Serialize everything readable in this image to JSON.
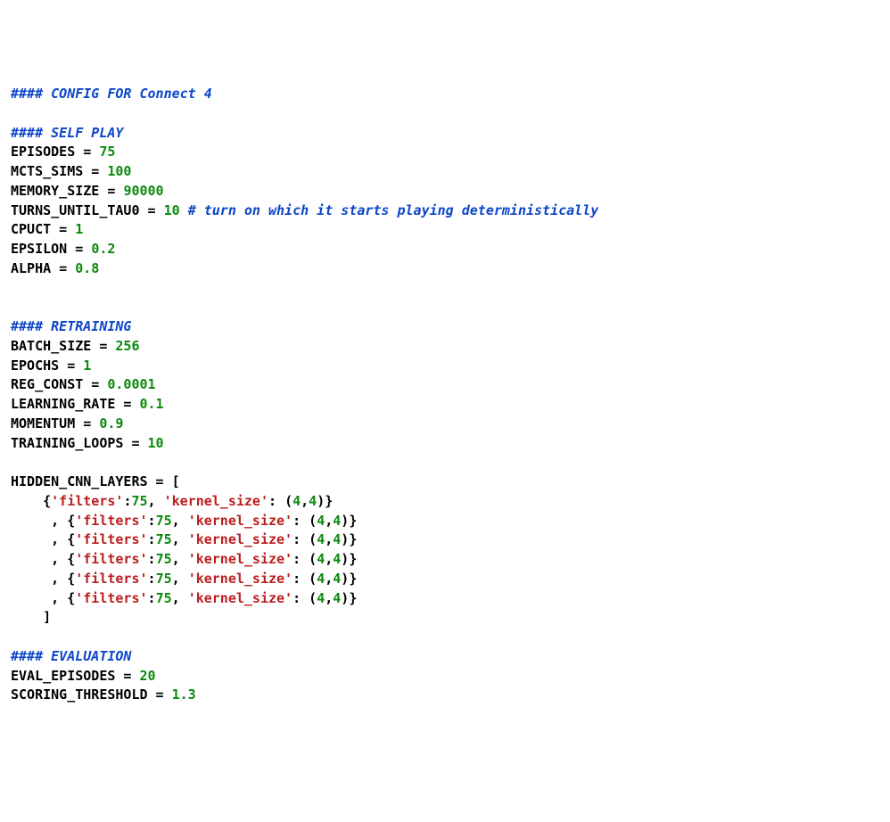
{
  "comments": {
    "title": "#### CONFIG FOR Connect 4",
    "selfplay": "#### SELF PLAY",
    "retraining": "#### RETRAINING",
    "evaluation": "#### EVALUATION",
    "tau_inline": "# turn on which it starts playing deterministically"
  },
  "selfplay": {
    "EPISODES": {
      "name": "EPISODES",
      "eq": " = ",
      "val": "75"
    },
    "MCTS_SIMS": {
      "name": "MCTS_SIMS",
      "eq": " = ",
      "val": "100"
    },
    "MEMORY_SIZE": {
      "name": "MEMORY_SIZE",
      "eq": " = ",
      "val": "90000"
    },
    "TURNS_UNTIL_TAU0": {
      "name": "TURNS_UNTIL_TAU0",
      "eq": " = ",
      "val": "10"
    },
    "CPUCT": {
      "name": "CPUCT",
      "eq": " = ",
      "val": "1"
    },
    "EPSILON": {
      "name": "EPSILON",
      "eq": " = ",
      "val": "0.2"
    },
    "ALPHA": {
      "name": "ALPHA",
      "eq": " = ",
      "val": "0.8"
    }
  },
  "retraining": {
    "BATCH_SIZE": {
      "name": "BATCH_SIZE",
      "eq": " = ",
      "val": "256"
    },
    "EPOCHS": {
      "name": "EPOCHS",
      "eq": " = ",
      "val": "1"
    },
    "REG_CONST": {
      "name": "REG_CONST",
      "eq": " = ",
      "val": "0.0001"
    },
    "LEARNING_RATE": {
      "name": "LEARNING_RATE",
      "eq": " = ",
      "val": "0.1"
    },
    "MOMENTUM": {
      "name": "MOMENTUM",
      "eq": " = ",
      "val": "0.9"
    },
    "TRAINING_LOOPS": {
      "name": "TRAINING_LOOPS",
      "eq": " = ",
      "val": "10"
    }
  },
  "hidden": {
    "name": "HIDDEN_CNN_LAYERS",
    "eq": " = ",
    "open": "[",
    "close": "]",
    "indent0": "    ",
    "indentN": "     , ",
    "layers": [
      {
        "pre": "{",
        "k_filters": "'filters'",
        "colon1": ":",
        "filters": "75",
        "sep": ", ",
        "k_kernel": "'kernel_size'",
        "colon2": ": ",
        "paren_o": "(",
        "k1": "4",
        "comma": ",",
        "k2": "4",
        "paren_c": ")",
        "post": "}"
      },
      {
        "pre": "{",
        "k_filters": "'filters'",
        "colon1": ":",
        "filters": "75",
        "sep": ", ",
        "k_kernel": "'kernel_size'",
        "colon2": ": ",
        "paren_o": "(",
        "k1": "4",
        "comma": ",",
        "k2": "4",
        "paren_c": ")",
        "post": "}"
      },
      {
        "pre": "{",
        "k_filters": "'filters'",
        "colon1": ":",
        "filters": "75",
        "sep": ", ",
        "k_kernel": "'kernel_size'",
        "colon2": ": ",
        "paren_o": "(",
        "k1": "4",
        "comma": ",",
        "k2": "4",
        "paren_c": ")",
        "post": "}"
      },
      {
        "pre": "{",
        "k_filters": "'filters'",
        "colon1": ":",
        "filters": "75",
        "sep": ", ",
        "k_kernel": "'kernel_size'",
        "colon2": ": ",
        "paren_o": "(",
        "k1": "4",
        "comma": ",",
        "k2": "4",
        "paren_c": ")",
        "post": "}"
      },
      {
        "pre": "{",
        "k_filters": "'filters'",
        "colon1": ":",
        "filters": "75",
        "sep": ", ",
        "k_kernel": "'kernel_size'",
        "colon2": ": ",
        "paren_o": "(",
        "k1": "4",
        "comma": ",",
        "k2": "4",
        "paren_c": ")",
        "post": "}"
      },
      {
        "pre": "{",
        "k_filters": "'filters'",
        "colon1": ":",
        "filters": "75",
        "sep": ", ",
        "k_kernel": "'kernel_size'",
        "colon2": ": ",
        "paren_o": "(",
        "k1": "4",
        "comma": ",",
        "k2": "4",
        "paren_c": ")",
        "post": "}"
      }
    ]
  },
  "evaluation": {
    "EVAL_EPISODES": {
      "name": "EVAL_EPISODES",
      "eq": " = ",
      "val": "20"
    },
    "SCORING_THRESHOLD": {
      "name": "SCORING_THRESHOLD",
      "eq": " = ",
      "val": "1.3"
    }
  }
}
